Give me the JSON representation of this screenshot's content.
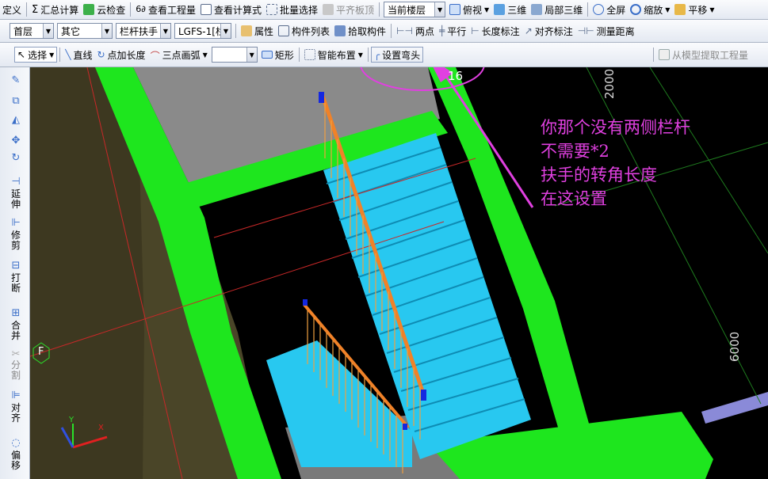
{
  "toolbar1": {
    "define": "定义",
    "sum_calc": "汇总计算",
    "cloud_check": "云检查",
    "view_quantity": "查看工程量",
    "view_formula": "查看计算式",
    "batch_select": "批量选择",
    "flat_slab": "平齐板顶",
    "floor_combo": "当前楼层",
    "top_view": "俯视",
    "three_d": "三维",
    "local_3d": "局部三维",
    "fullscreen": "全屏",
    "zoom": "缩放",
    "pan": "平移"
  },
  "toolbar2": {
    "floor": "首层",
    "category": "其它",
    "member_type": "栏杆扶手",
    "member_name": "LGFS-1[栏",
    "properties": "属性",
    "member_list": "构件列表",
    "pick_member": "拾取构件",
    "two_points": "两点",
    "parallel": "平行",
    "length_dim": "长度标注",
    "align_dim": "对齐标注",
    "measure_dist": "测量距离"
  },
  "toolbar3": {
    "select": "选择",
    "line": "直线",
    "point_length": "点加长度",
    "three_point_arc": "三点画弧",
    "rect": "矩形",
    "smart_layout": "智能布置",
    "set_elbow": "设置弯头",
    "extract_qty": "从模型提取工程量"
  },
  "leftbar": {
    "extend": "延伸",
    "trim": "修剪",
    "break": "打断",
    "merge": "合并",
    "split": "分割",
    "align": "对齐",
    "offset": "偏移"
  },
  "viewport": {
    "dim_top": "2000",
    "dim_right": "6000",
    "circle_num": "16",
    "axis_f": "F",
    "axis_x": "X",
    "axis_y": "Y"
  },
  "annotation": {
    "line1": "你那个没有两侧栏杆",
    "line2": "不需要*2",
    "line3": "扶手的转角长度",
    "line4": "在这设置"
  },
  "colors": {
    "beam_green": "#1ee61e",
    "stair_cyan": "#28c8f0",
    "rail_orange": "#f08228",
    "wall_olive": "#4a4528",
    "annotation_magenta": "#e040e0",
    "slab_gray": "#8a8a8a"
  }
}
